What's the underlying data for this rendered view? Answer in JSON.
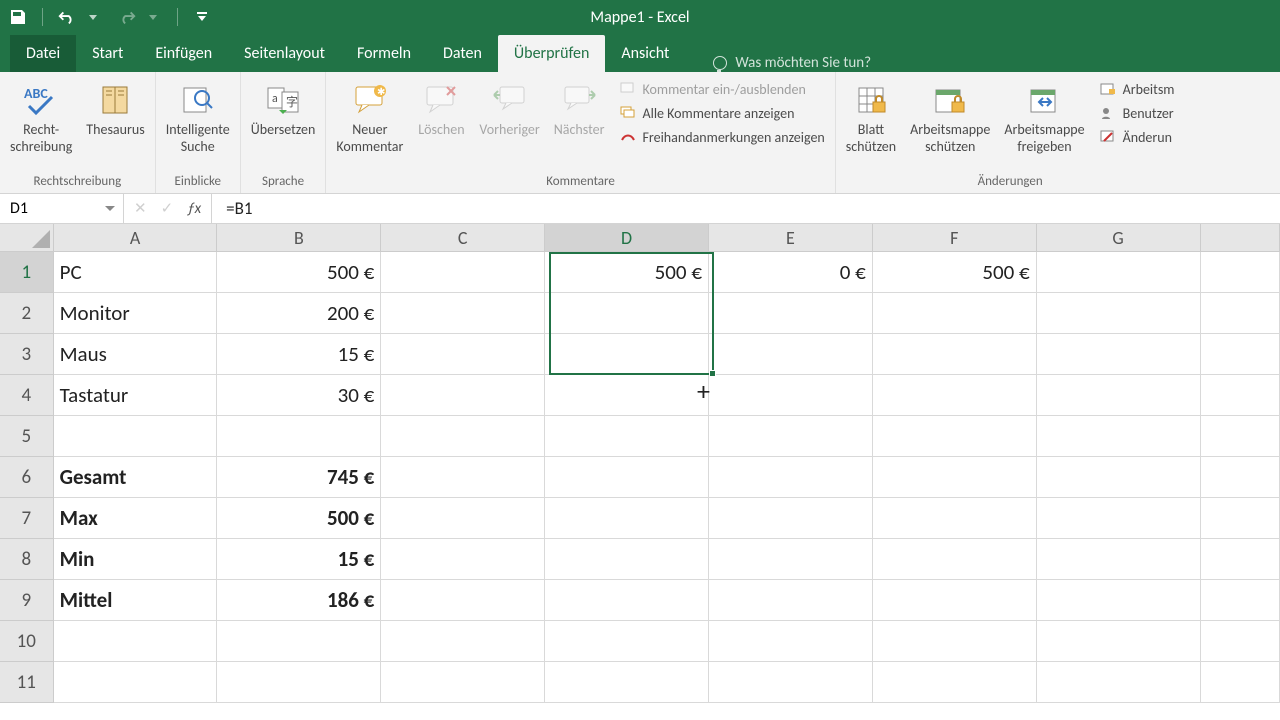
{
  "app": {
    "title": "Mappe1 - Excel"
  },
  "qat": {
    "save": "save-icon",
    "undo": "undo-icon",
    "redo": "redo-icon"
  },
  "tabs": {
    "file": "Datei",
    "items": [
      "Start",
      "Einfügen",
      "Seitenlayout",
      "Formeln",
      "Daten",
      "Überprüfen",
      "Ansicht"
    ],
    "active_index": 5,
    "tellme": "Was möchten Sie tun?"
  },
  "ribbon": {
    "groups": [
      {
        "label": "Rechtschreibung",
        "buttons": [
          {
            "label": "Recht-\nschreibung",
            "icon": "abc-check"
          },
          {
            "label": "Thesaurus",
            "icon": "book"
          }
        ]
      },
      {
        "label": "Einblicke",
        "buttons": [
          {
            "label": "Intelligente\nSuche",
            "icon": "smart-lookup"
          }
        ]
      },
      {
        "label": "Sprache",
        "buttons": [
          {
            "label": "Übersetzen",
            "icon": "translate"
          }
        ]
      },
      {
        "label": "Kommentare",
        "buttons": [
          {
            "label": "Neuer\nKommentar",
            "icon": "comment-new"
          },
          {
            "label": "Löschen",
            "icon": "comment-delete"
          },
          {
            "label": "Vorheriger",
            "icon": "comment-prev"
          },
          {
            "label": "Nächster",
            "icon": "comment-next"
          }
        ],
        "list": [
          {
            "label": "Kommentar ein-/ausblenden",
            "icon": "comment-toggle"
          },
          {
            "label": "Alle Kommentare anzeigen",
            "icon": "comments-all"
          },
          {
            "label": "Freihandanmerkungen anzeigen",
            "icon": "ink"
          }
        ]
      },
      {
        "label": "Änderungen",
        "buttons": [
          {
            "label": "Blatt\nschützen",
            "icon": "protect-sheet"
          },
          {
            "label": "Arbeitsmappe\nschützen",
            "icon": "protect-workbook"
          },
          {
            "label": "Arbeitsmappe\nfreigeben",
            "icon": "share-workbook"
          }
        ],
        "list": [
          {
            "label": "Arbeitsm",
            "icon": "protect-share"
          },
          {
            "label": "Benutzer",
            "icon": "allow-users"
          },
          {
            "label": "Änderun",
            "icon": "track-changes"
          }
        ]
      }
    ]
  },
  "formula_bar": {
    "name_box": "D1",
    "formula": "=B1"
  },
  "columns": [
    "A",
    "B",
    "C",
    "D",
    "E",
    "F",
    "G"
  ],
  "active_column": "D",
  "active_row": 1,
  "selection": {
    "top_row": 1,
    "bottom_row": 3,
    "col": "D"
  },
  "cells": {
    "A1": "PC",
    "B1": "500 €",
    "D1": "500 €",
    "E1": "0 €",
    "F1": "500 €",
    "A2": "Monitor",
    "B2": "200 €",
    "A3": "Maus",
    "B3": "15 €",
    "A4": "Tastatur",
    "B4": "30 €",
    "A6": "Gesamt",
    "B6": "745 €",
    "A7": "Max",
    "B7": "500 €",
    "A8": "Min",
    "B8": "15 €",
    "A9": "Mittel",
    "B9": "186 €"
  },
  "row_count": 11
}
